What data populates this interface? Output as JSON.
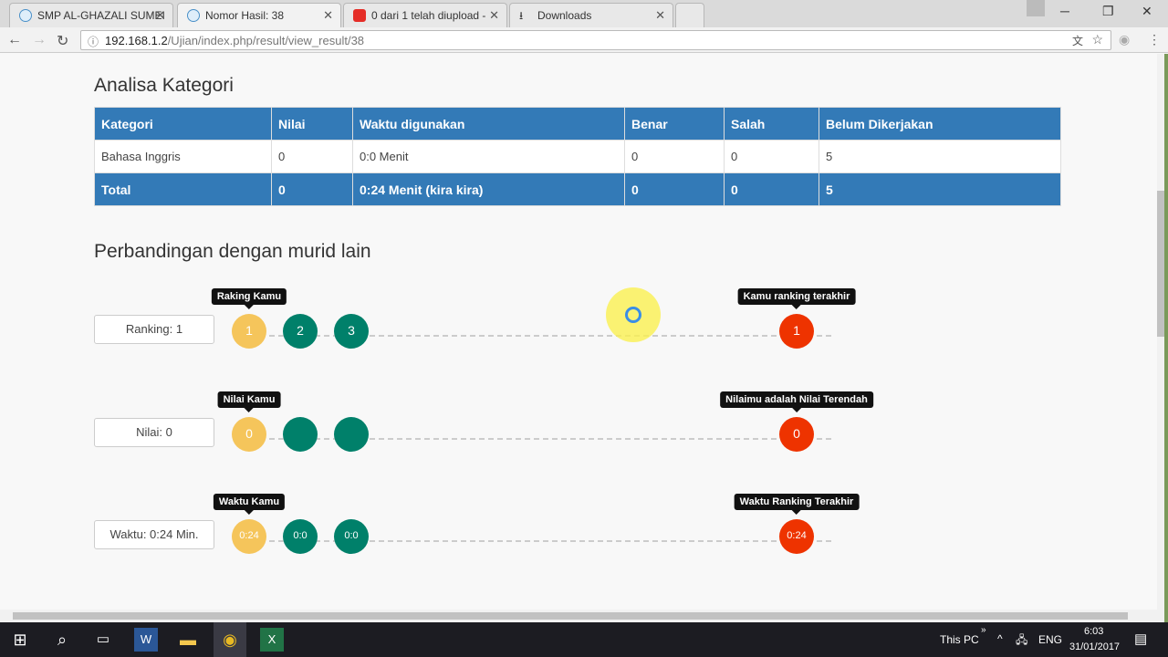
{
  "browser": {
    "tabs": [
      {
        "title": "SMP AL-GHAZALI SUMEI"
      },
      {
        "title": "Nomor Hasil: 38",
        "active": true
      },
      {
        "title": "0 dari 1 telah diupload -"
      },
      {
        "title": "Downloads"
      }
    ],
    "url_host": "192.168.1.2",
    "url_path": "/Ujian/index.php/result/view_result/38"
  },
  "analisa": {
    "title": "Analisa Kategori",
    "headers": [
      "Kategori",
      "Nilai",
      "Waktu digunakan",
      "Benar",
      "Salah",
      "Belum Dikerjakan"
    ],
    "rows": [
      [
        "Bahasa Inggris",
        "0",
        "0:0 Menit",
        "0",
        "0",
        "5"
      ]
    ],
    "total": [
      "Total",
      "0",
      "0:24 Menit (kira kira)",
      "0",
      "0",
      "5"
    ]
  },
  "perbandingan": {
    "title": "Perbandingan dengan murid lain",
    "rows": [
      {
        "label": "Ranking: 1",
        "tip_left": "Raking Kamu",
        "tip_right": "Kamu ranking terakhir",
        "dots": [
          "1",
          "2",
          "3"
        ],
        "last": "1"
      },
      {
        "label": "Nilai: 0",
        "tip_left": "Nilai Kamu",
        "tip_right": "Nilaimu adalah Nilai Terendah",
        "dots": [
          "0",
          "",
          ""
        ],
        "last": "0"
      },
      {
        "label": "Waktu: 0:24 Min.",
        "tip_left": "Waktu Kamu",
        "tip_right": "Waktu Ranking Terakhir",
        "dots": [
          "0:24",
          "0:0",
          "0:0"
        ],
        "last": "0:24"
      }
    ]
  },
  "colors": {
    "header": "#337ab7",
    "you": "#f5c55b",
    "others": "#00806a",
    "last": "#ee3300"
  },
  "taskbar": {
    "this_pc": "This PC",
    "lang": "ENG",
    "time": "6:03",
    "date": "31/01/2017"
  }
}
